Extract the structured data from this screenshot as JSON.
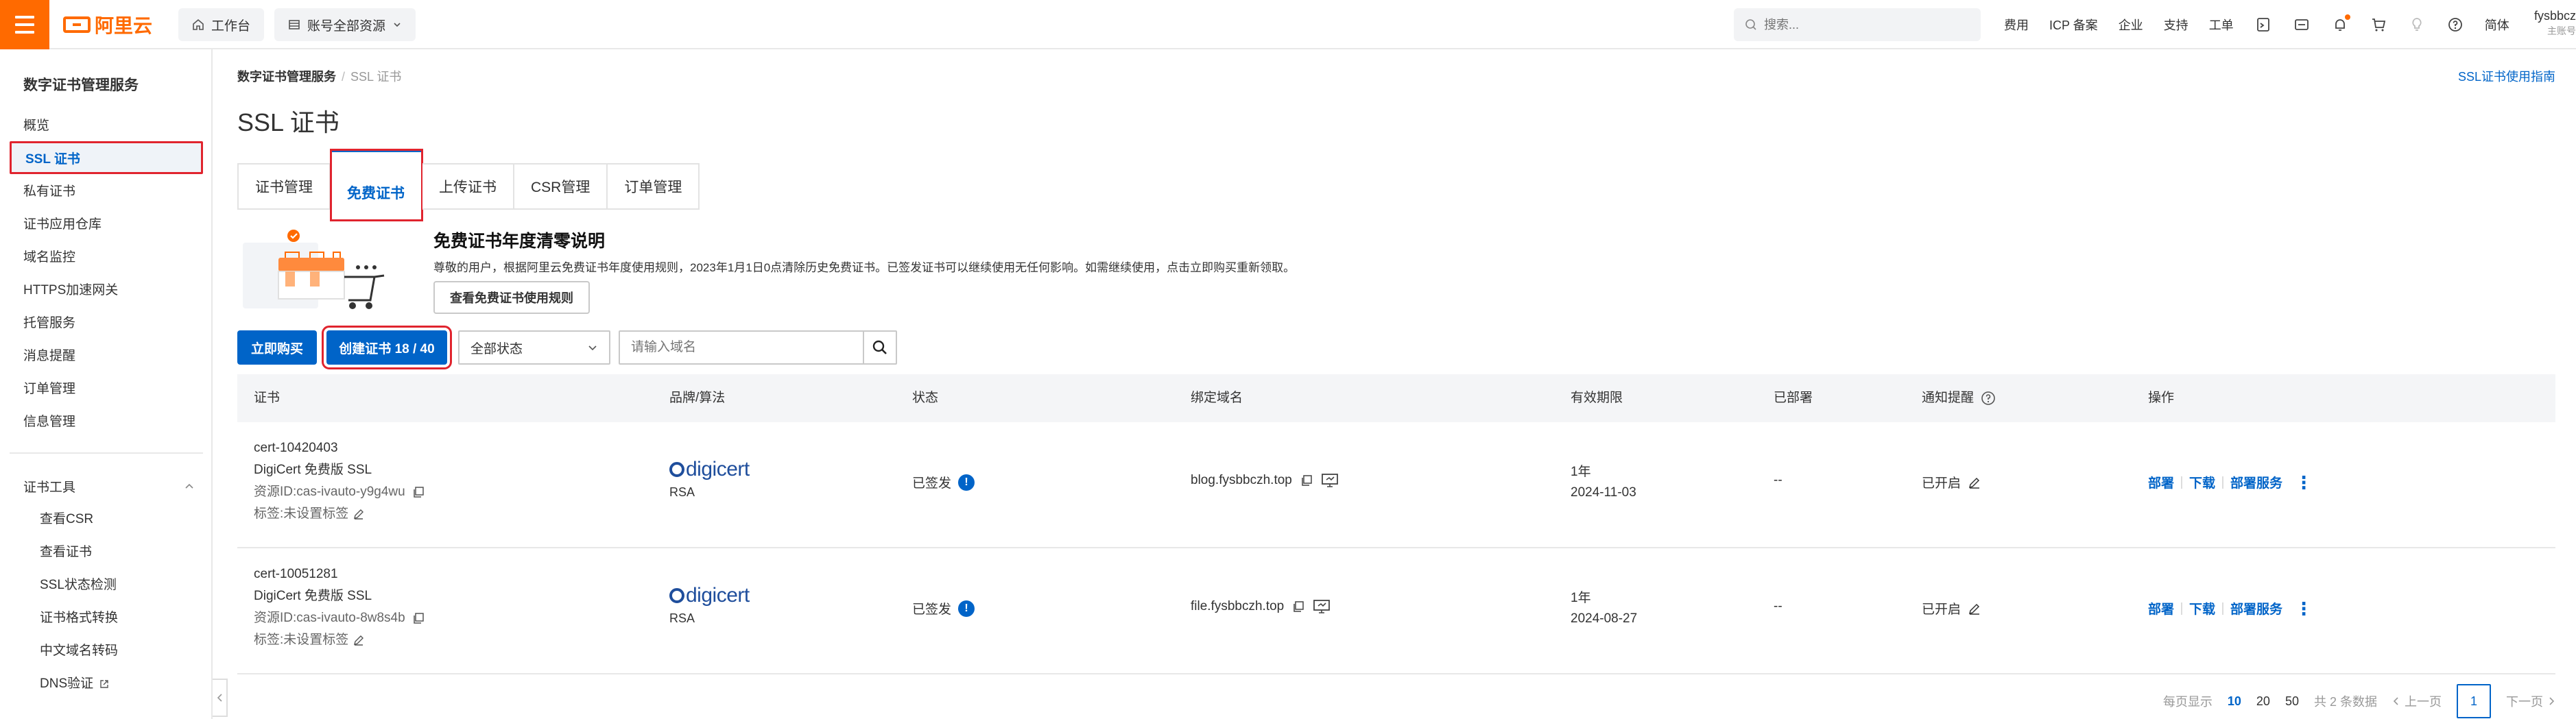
{
  "header": {
    "brand": "阿里云",
    "workbench": "工作台",
    "resource_scope": "账号全部资源",
    "search_placeholder": "搜索...",
    "links": [
      "费用",
      "ICP 备案",
      "企业",
      "支持",
      "工单"
    ],
    "lang": "简体",
    "user_name": "fysbbcz",
    "user_sub": "主账号"
  },
  "sidebar": {
    "title": "数字证书管理服务",
    "items": [
      "概览",
      "SSL 证书",
      "私有证书",
      "证书应用仓库",
      "域名监控",
      "HTTPS加速网关",
      "托管服务",
      "消息提醒",
      "订单管理",
      "信息管理"
    ],
    "tools_title": "证书工具",
    "tools": [
      "查看CSR",
      "查看证书",
      "SSL状态检测",
      "证书格式转换",
      "中文域名转码",
      "DNS验证"
    ]
  },
  "main": {
    "breadcrumb_root": "数字证书管理服务",
    "breadcrumb_current": "SSL 证书",
    "guide_link": "SSL证书使用指南",
    "title": "SSL 证书",
    "tabs": [
      "证书管理",
      "免费证书",
      "上传证书",
      "CSR管理",
      "订单管理"
    ],
    "notice": {
      "title": "免费证书年度清零说明",
      "text": "尊敬的用户，根据阿里云免费证书年度使用规则，2023年1月1日0点清除历史免费证书。已签发证书可以继续使用无任何影响。如需继续使用，点击立即购买重新领取。",
      "button": "查看免费证书使用规则"
    },
    "toolbar": {
      "buy": "立即购买",
      "create": "创建证书 18 / 40",
      "status_filter": "全部状态",
      "domain_placeholder": "请输入域名"
    },
    "columns": [
      "证书",
      "品牌/算法",
      "状态",
      "绑定域名",
      "有效期限",
      "已部署",
      "通知提醒",
      "操作"
    ],
    "rows": [
      {
        "cert_id": "cert-10420403",
        "cert_name": "DigiCert 免费版 SSL",
        "resource_id": "资源ID:cas-ivauto-y9g4wu",
        "tags": "标签:未设置标签",
        "brand": "digicert",
        "algo": "RSA",
        "status": "已签发",
        "domain": "blog.fysbbczh.top",
        "validity_term": "1年",
        "validity_date": "2024-11-03",
        "deployed": "--",
        "notify": "已开启",
        "ops": [
          "部署",
          "下载",
          "部署服务"
        ]
      },
      {
        "cert_id": "cert-10051281",
        "cert_name": "DigiCert 免费版 SSL",
        "resource_id": "资源ID:cas-ivauto-8w8s4b",
        "tags": "标签:未设置标签",
        "brand": "digicert",
        "algo": "RSA",
        "status": "已签发",
        "domain": "file.fysbbczh.top",
        "validity_term": "1年",
        "validity_date": "2024-08-27",
        "deployed": "--",
        "notify": "已开启",
        "ops": [
          "部署",
          "下载",
          "部署服务"
        ]
      }
    ],
    "pager": {
      "per_page_label": "每页显示",
      "sizes": [
        "10",
        "20",
        "50"
      ],
      "total": "共 2 条数据",
      "prev": "上一页",
      "current": "1",
      "next": "下一页"
    }
  },
  "colors": {
    "accent": "#0064c8",
    "brand": "#ff6a00",
    "highlight": "#e0242e"
  }
}
